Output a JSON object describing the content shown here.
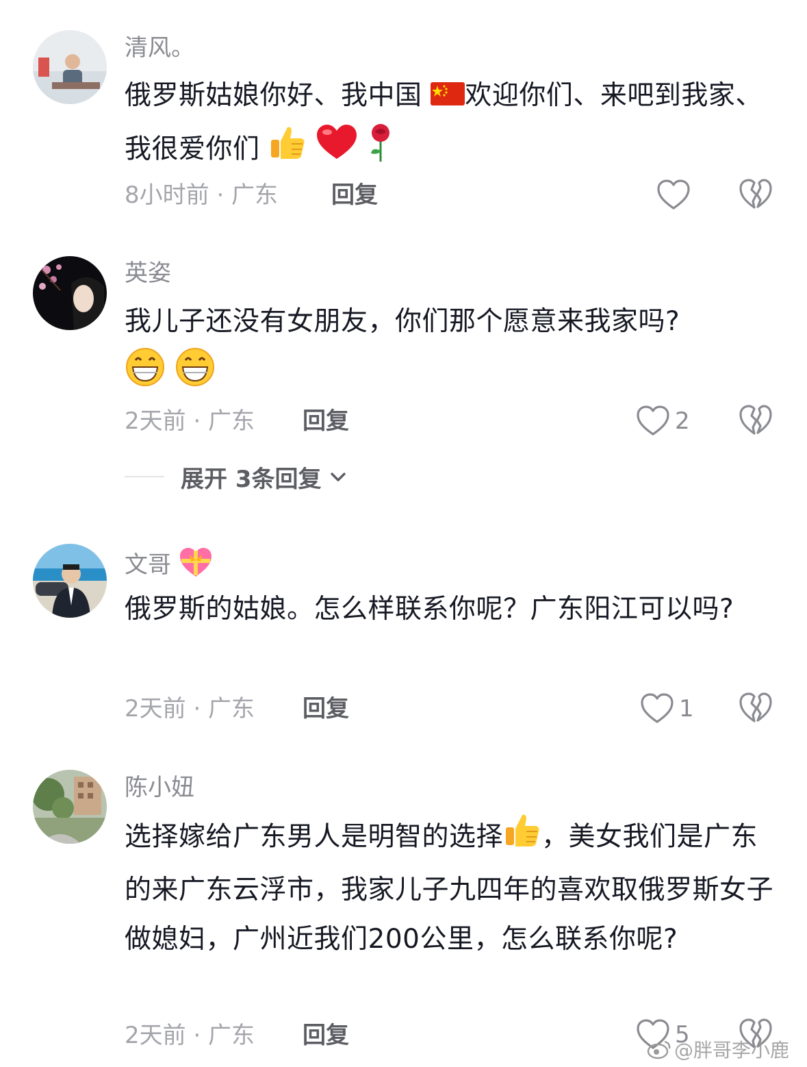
{
  "comments": [
    {
      "username": "清风。",
      "text_parts": [
        "俄罗斯姑娘你好、我中国",
        "欢迎你们、来吧到我家、我很爱你们"
      ],
      "emojis": [
        "china-flag",
        "thumbs-up",
        "red-heart",
        "rose"
      ],
      "time_location": "8小时前 · 广东",
      "reply_label": "回复",
      "likes": ""
    },
    {
      "username": "英姿",
      "text": "我儿子还没有女朋友，你们那个愿意来我家吗?",
      "emojis": [
        "grinning-face",
        "grinning-face"
      ],
      "time_location": "2天前 · 广东",
      "reply_label": "回复",
      "likes": "2",
      "expand_label": "展开 3条回复"
    },
    {
      "username": "文哥",
      "username_emoji": "heart-with-ribbon",
      "text": "俄罗斯的姑娘。怎么样联系你呢？广东阳江可以吗?",
      "time_location": "2天前 · 广东",
      "reply_label": "回复",
      "likes": "1"
    },
    {
      "username": "陈小妞",
      "text_parts": [
        "选择嫁给广东男人是明智的选择",
        "，美女我们是广东的来广东云浮市，我家儿子九四年的喜欢取俄罗斯女子做媳妇，广州近我们200公里，怎么联系你呢?"
      ],
      "emojis": [
        "thumbs-up"
      ],
      "time_location": "2天前 · 广东",
      "reply_label": "回复",
      "likes": "5"
    }
  ],
  "watermark": "@胖哥李小鹿",
  "colors": {
    "text": "#161823",
    "username": "#8a8b91",
    "meta": "#a4a5ab",
    "reply": "#5c5d63"
  }
}
